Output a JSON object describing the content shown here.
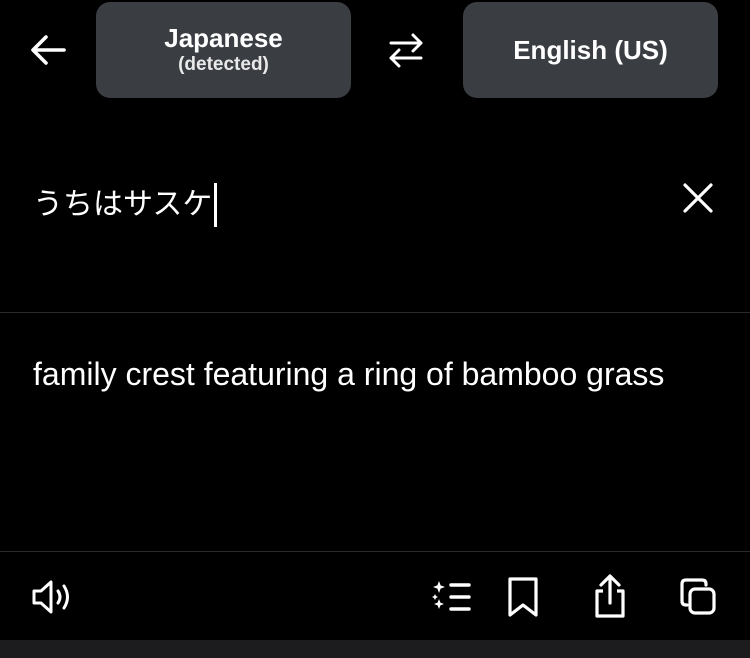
{
  "header": {
    "source_language": "Japanese",
    "source_language_note": "(detected)",
    "target_language": "English (US)"
  },
  "source": {
    "text": "うちはサスケ"
  },
  "translation": {
    "text": "family crest featuring a ring of bamboo grass"
  },
  "toolbar": {
    "icons": [
      "speaker-icon",
      "phrase-list-icon",
      "bookmark-icon",
      "share-icon",
      "copy-icon"
    ]
  },
  "colors": {
    "background": "#000000",
    "button_fill": "#3a3d42",
    "text": "#ffffff",
    "divider": "#2a2a2c",
    "bottom_bar": "#1c1c1e"
  }
}
